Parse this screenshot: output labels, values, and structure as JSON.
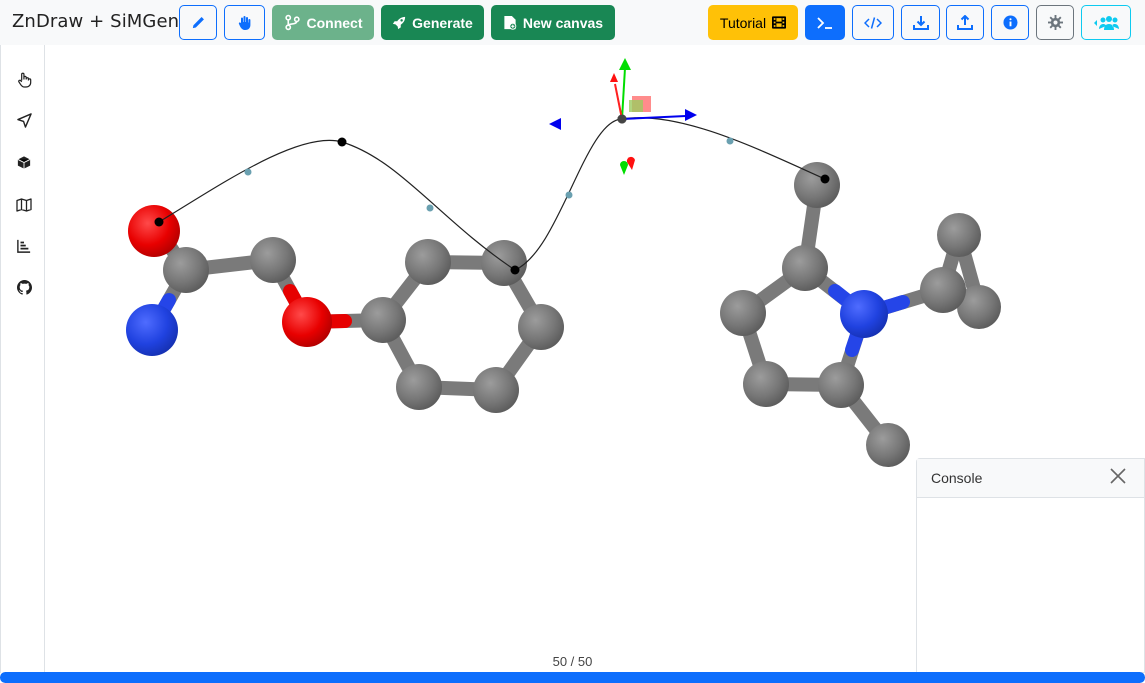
{
  "header": {
    "title": "ZnDraw + SiMGen",
    "buttons": {
      "draw_icon": "pencil-icon",
      "interaction_icon": "hand-icon",
      "connect_label": "Connect",
      "generate_label": "Generate",
      "new_canvas_label": "New canvas",
      "tutorial_label": "Tutorial",
      "terminal_icon": "terminal-icon",
      "code_icon": "code-icon",
      "download_icon": "download-icon",
      "upload_icon": "upload-icon",
      "info_icon": "info-icon",
      "settings_icon": "gear-icon",
      "users_icon": "users-icon"
    }
  },
  "sidebar": {
    "items": [
      {
        "icon": "pointer-hand-icon"
      },
      {
        "icon": "navigation-arrow-icon"
      },
      {
        "icon": "cube-icon"
      },
      {
        "icon": "map-icon"
      },
      {
        "icon": "bar-chart-icon"
      },
      {
        "icon": "github-icon"
      }
    ]
  },
  "console": {
    "title": "Console"
  },
  "player": {
    "counter": "50 / 50",
    "progress": 1.0
  },
  "colors": {
    "primary": "#0d6efd",
    "success": "#198754",
    "warning": "#ffc107",
    "info": "#0dcaf0",
    "carbon": "#7a7a7a",
    "oxygen": "#ff0000",
    "nitrogen": "#2545e8"
  }
}
